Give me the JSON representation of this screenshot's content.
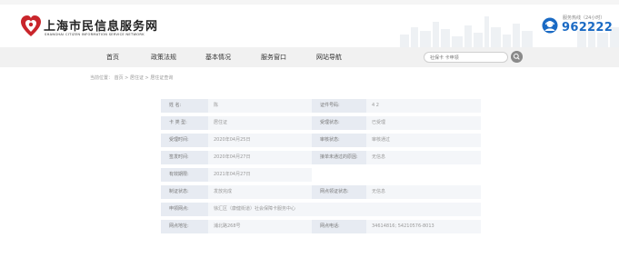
{
  "header": {
    "logo_cn": "上海市民信息服务网",
    "logo_en": "SHANGHAI CITIZEN INFORMATION SERVICE NETWORK",
    "hotline_label": "服务热线（24小时）",
    "hotline_number": "962222"
  },
  "nav": {
    "items": [
      {
        "label": "首页"
      },
      {
        "label": "政策法规"
      },
      {
        "label": "基本情况"
      },
      {
        "label": "服务窗口"
      },
      {
        "label": "网站导航"
      }
    ]
  },
  "search": {
    "placeholder": "社保卡 卡申领"
  },
  "breadcrumb": "当前位置： 首页 > 居住证 > 居住证查询",
  "record": {
    "rows": [
      {
        "l1": "姓  名:",
        "v1": "陈",
        "l2": "证件号码:",
        "v2": "4                                   2"
      },
      {
        "l1": "卡 类 型:",
        "v1": "居住证",
        "l2": "受理状态:",
        "v2": "已受理"
      },
      {
        "l1": "受理时间:",
        "v1": "2020年04月25日",
        "l2": "审核状态:",
        "v2": "审核通过"
      },
      {
        "l1": "签发时间:",
        "v1": "2020年04月27日",
        "l2": "接单未通过的原因:",
        "v2": "无信息"
      },
      {
        "l1": "有效期限:",
        "v1": "2021年04月27日"
      },
      {
        "l1": "制证状态:",
        "v1": "发放完成",
        "l2": "网点领证状态:",
        "v2": "无信息"
      },
      {
        "l1": "申领网点:",
        "v1": "徐汇区（康健街道）社会保障卡服务中心"
      },
      {
        "l1": "网点地址:",
        "v1": "浦北路268号",
        "l2": "网点电话:",
        "v2": "34614816; 54210576-8013"
      }
    ]
  },
  "colors": {
    "hotline_blue": "#1a6ac4",
    "logo_red": "#c9252b",
    "label_bg": "#e7ebf2",
    "row_bg": "#f4f6f9"
  }
}
